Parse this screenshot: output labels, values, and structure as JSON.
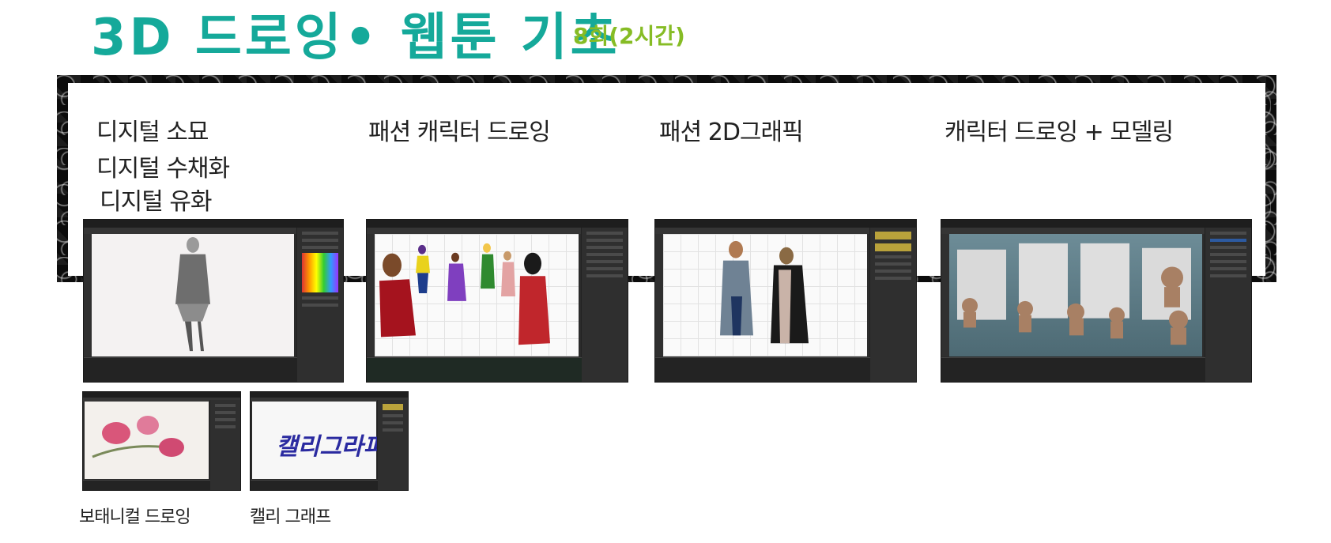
{
  "header": {
    "title": "3D 드로잉• 웹툰 기초",
    "subtitle": "8회(2시간)"
  },
  "categories": [
    {
      "lines": [
        "디지털 소묘",
        "디지털 수채화",
        "디지털 유화"
      ]
    },
    {
      "lines": [
        "패션 캐릭터 드로잉"
      ]
    },
    {
      "lines": [
        "패션 2D그래픽"
      ]
    },
    {
      "lines": [
        "캐릭터 드로잉 + 모델링"
      ]
    }
  ],
  "bottom": {
    "botanical": "보태니컬 드로잉",
    "calligraphy": "캘리 그래프",
    "calligraphy_artwork": "캘리그라피"
  },
  "colors": {
    "title": "#15a99a",
    "subtitle": "#86bc25",
    "calligraphy_ink": [
      "#c0186d",
      "#6b2fa0",
      "#e08a1a",
      "#2a2aa0"
    ]
  }
}
